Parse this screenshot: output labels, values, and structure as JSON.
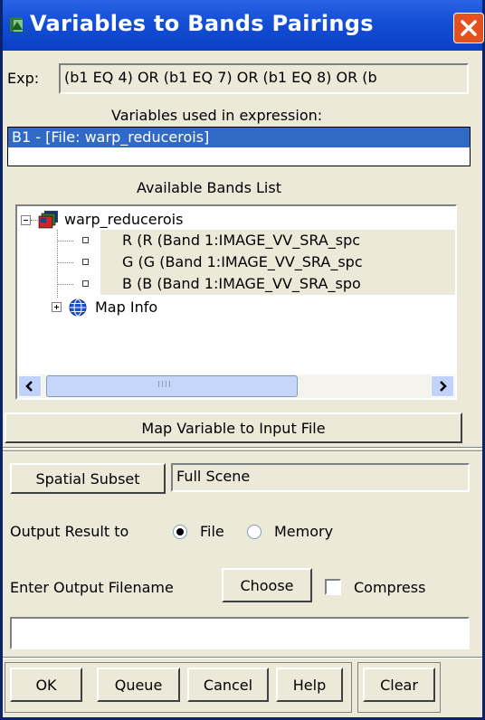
{
  "window": {
    "title": "Variables to Bands Pairings",
    "close_icon": "close-icon"
  },
  "expression": {
    "label": "Exp:",
    "value": "(b1 EQ 4) OR (b1 EQ 7) OR (b1 EQ 8) OR (b"
  },
  "variables": {
    "heading": "Variables used in expression:",
    "items": [
      "B1 - [File: warp_reducerois]"
    ]
  },
  "bands": {
    "heading": "Available Bands List",
    "root": "warp_reducerois",
    "items": [
      "R (R (Band 1:IMAGE_VV_SRA_spc",
      "G (G (Band 1:IMAGE_VV_SRA_spc",
      "B (B (Band 1:IMAGE_VV_SRA_spo"
    ],
    "map_info": "Map Info",
    "scrollbar_grip": "IIII"
  },
  "buttons": {
    "map_variable": "Map Variable to Input File",
    "spatial_subset": "Spatial Subset",
    "choose": "Choose",
    "ok": "OK",
    "queue": "Queue",
    "cancel": "Cancel",
    "help": "Help",
    "clear": "Clear"
  },
  "subset": {
    "value": "Full Scene"
  },
  "output": {
    "label": "Output Result to",
    "option_file": "File",
    "option_memory": "Memory",
    "selected": "File"
  },
  "filename": {
    "label": "Enter Output Filename",
    "value": "",
    "compress_label": "Compress",
    "compress_checked": false
  },
  "colors": {
    "titlebar": "#0A3FC6",
    "selection": "#3169C6",
    "dialog_bg": "#ECE9D8",
    "close_button": "#E4501E"
  }
}
